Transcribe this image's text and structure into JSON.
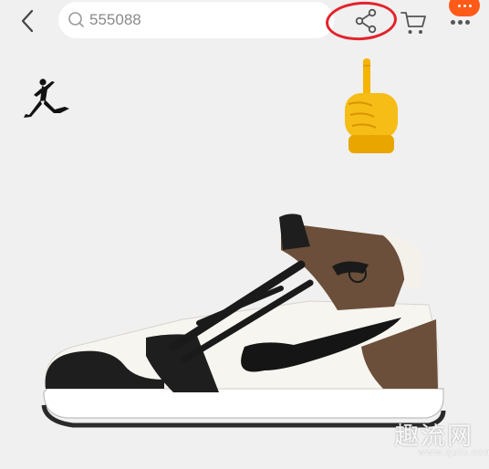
{
  "search": {
    "query": "555088"
  },
  "toolbar": {
    "back_icon": "chevron-left-icon",
    "share_icon": "share-icon",
    "cart_icon": "shopping-cart-icon",
    "more_icon": "more-dots-icon"
  },
  "annotation": {
    "highlight_color": "#e3232c",
    "pointer": "pointing-down-hand"
  },
  "product": {
    "image": "sneaker-image",
    "brand_logo": "jumpman-logo"
  },
  "colors": {
    "badge": "#ff5a17",
    "background": "#f0f0f0",
    "accent_brown": "#6b4f3a"
  },
  "watermark": {
    "text": "趣流网",
    "url": "www.qulu.com"
  }
}
